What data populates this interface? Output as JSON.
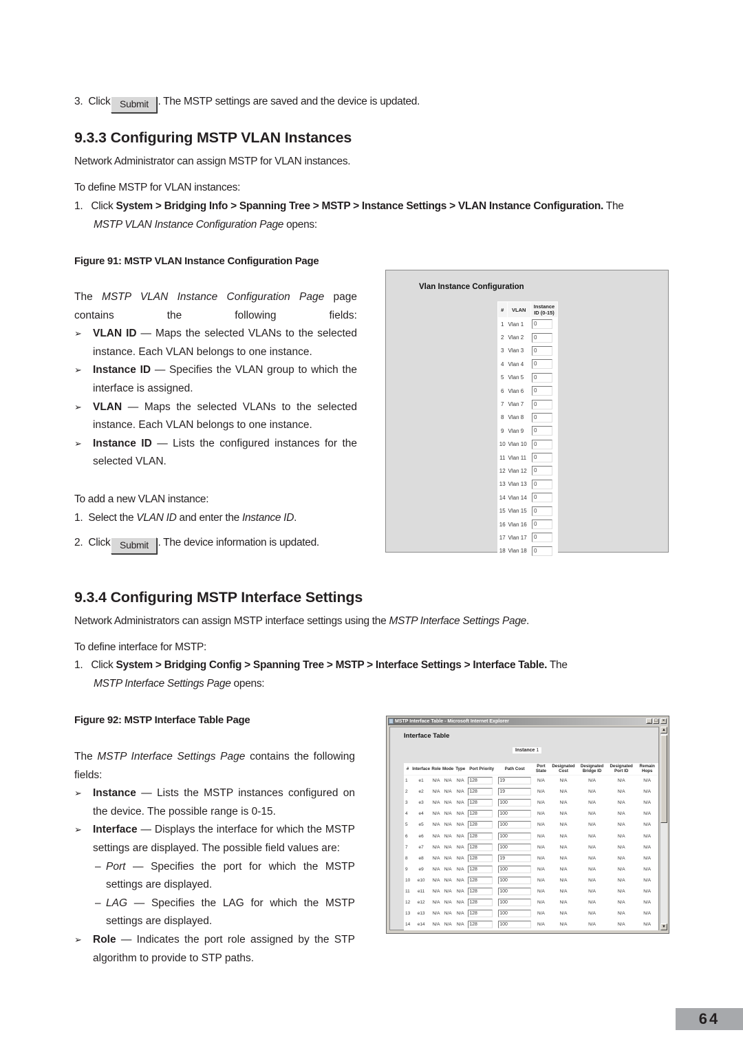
{
  "step3_top": {
    "num": "3.",
    "click": "Click",
    "button": "Submit",
    "rest": ". The MSTP settings are saved and the device is updated."
  },
  "section_933": {
    "heading": "9.3.3  Configuring MSTP VLAN Instances",
    "intro": "Network Administrator can assign MSTP for VLAN instances.",
    "define": "To define MSTP for VLAN instances:",
    "step1": {
      "num": "1.",
      "click": "Click",
      "path": "System > Bridging Info > Spanning Tree > MSTP > Instance Settings > VLAN Instance Configuration.",
      "the": "The",
      "page_name": "MSTP VLAN Instance Configuration Page",
      "opens": "opens:"
    },
    "figure_caption": "Figure 91: MSTP VLAN Instance Configuration Page",
    "fields_intro": {
      "the": "The",
      "page_name": "MSTP VLAN Instance Configuration Page",
      "rest": "page contains the following fields:"
    },
    "fields": [
      {
        "name": "VLAN ID",
        "desc": "— Maps the selected VLANs to the selected instance. Each VLAN belongs to one instance."
      },
      {
        "name": "Instance ID",
        "desc": "— Specifies the VLAN group to which the interface is assigned."
      },
      {
        "name": "VLAN",
        "desc": "— Maps the selected VLANs to the selected instance. Each VLAN belongs to one instance."
      },
      {
        "name": "Instance ID",
        "desc": "— Lists the configured instances for the selected VLAN."
      }
    ],
    "add_intro": "To add a new VLAN instance:",
    "add_step1": {
      "num": "1.",
      "pre": "Select the",
      "vlan_id": "VLAN ID",
      "mid": "and enter the",
      "instance_id": "Instance ID",
      "post": "."
    },
    "add_step2": {
      "num": "2.",
      "click": "Click",
      "button": "Submit",
      "rest": ". The device information is updated."
    }
  },
  "vlan_figure": {
    "title": "Vlan Instance Configuration",
    "headers": [
      "#",
      "VLAN",
      "Instance ID (0-15)"
    ],
    "rows": [
      {
        "num": "1",
        "vlan": "Vlan 1",
        "instance": "0"
      },
      {
        "num": "2",
        "vlan": "Vlan 2",
        "instance": "0"
      },
      {
        "num": "3",
        "vlan": "Vlan 3",
        "instance": "0"
      },
      {
        "num": "4",
        "vlan": "Vlan 4",
        "instance": "0"
      },
      {
        "num": "5",
        "vlan": "Vlan 5",
        "instance": "0"
      },
      {
        "num": "6",
        "vlan": "Vlan 6",
        "instance": "0"
      },
      {
        "num": "7",
        "vlan": "Vlan 7",
        "instance": "0"
      },
      {
        "num": "8",
        "vlan": "Vlan 8",
        "instance": "0"
      },
      {
        "num": "9",
        "vlan": "Vlan 9",
        "instance": "0"
      },
      {
        "num": "10",
        "vlan": "Vlan 10",
        "instance": "0"
      },
      {
        "num": "11",
        "vlan": "Vlan 11",
        "instance": "0"
      },
      {
        "num": "12",
        "vlan": "Vlan 12",
        "instance": "0"
      },
      {
        "num": "13",
        "vlan": "Vlan 13",
        "instance": "0"
      },
      {
        "num": "14",
        "vlan": "Vlan 14",
        "instance": "0"
      },
      {
        "num": "15",
        "vlan": "Vlan 15",
        "instance": "0"
      },
      {
        "num": "16",
        "vlan": "Vlan 16",
        "instance": "0"
      },
      {
        "num": "17",
        "vlan": "Vlan 17",
        "instance": "0"
      },
      {
        "num": "18",
        "vlan": "Vlan 18",
        "instance": "0"
      }
    ]
  },
  "section_934": {
    "heading": "9.3.4  Configuring MSTP Interface Settings",
    "intro_pre": "Network Administrators can assign MSTP interface settings using the",
    "intro_page": "MSTP Interface Settings Page",
    "intro_post": ".",
    "define": "To define interface for MSTP:",
    "step1": {
      "num": "1.",
      "click": "Click",
      "path": "System > Bridging Config > Spanning Tree > MSTP > Interface Settings > Interface Table.",
      "the": "The",
      "page_name": "MSTP Interface Settings Page",
      "opens": "opens:"
    },
    "figure_caption": "Figure 92: MSTP Interface Table Page",
    "fields_intro": {
      "the": "The",
      "page_name": "MSTP Interface Settings Page",
      "rest": "contains the following fields:"
    },
    "fields": [
      {
        "name": "Instance",
        "desc": "— Lists the MSTP instances configured on the device. The possible range is 0-15."
      },
      {
        "name": "Interface",
        "desc": "— Displays the interface for which the MSTP settings are displayed. The possible field values are:"
      },
      {
        "name": "Role",
        "desc": "— Indicates the port role assigned by the STP algorithm to provide to STP paths."
      }
    ],
    "sub_values": [
      {
        "name": "Port",
        "desc": "— Specifies the port for which the MSTP settings are displayed."
      },
      {
        "name": "LAG",
        "desc": "— Specifies the LAG for which the MSTP settings are displayed."
      }
    ]
  },
  "interface_figure": {
    "window_title": "MSTP Interface Table - Microsoft Internet Explorer",
    "page_title": "Interface Table",
    "instance_label": "Instance",
    "instance_value": "1",
    "headers": [
      "#",
      "Interface",
      "Role",
      "Mode",
      "Type",
      "Port Priority",
      "Path Cost",
      "Port State",
      "Designated Cost",
      "Designated Bridge ID",
      "Designated Port ID",
      "Remain Hops"
    ],
    "rows": [
      {
        "num": "1",
        "iface": "e1",
        "role": "N/A",
        "mode": "N/A",
        "type": "N/A",
        "priority": "128",
        "cost": "19",
        "state": "N/A",
        "dcost": "N/A",
        "dbridge": "N/A",
        "dport": "N/A",
        "hops": "N/A"
      },
      {
        "num": "2",
        "iface": "e2",
        "role": "N/A",
        "mode": "N/A",
        "type": "N/A",
        "priority": "128",
        "cost": "19",
        "state": "N/A",
        "dcost": "N/A",
        "dbridge": "N/A",
        "dport": "N/A",
        "hops": "N/A"
      },
      {
        "num": "3",
        "iface": "e3",
        "role": "N/A",
        "mode": "N/A",
        "type": "N/A",
        "priority": "128",
        "cost": "100",
        "state": "N/A",
        "dcost": "N/A",
        "dbridge": "N/A",
        "dport": "N/A",
        "hops": "N/A"
      },
      {
        "num": "4",
        "iface": "e4",
        "role": "N/A",
        "mode": "N/A",
        "type": "N/A",
        "priority": "128",
        "cost": "100",
        "state": "N/A",
        "dcost": "N/A",
        "dbridge": "N/A",
        "dport": "N/A",
        "hops": "N/A"
      },
      {
        "num": "5",
        "iface": "e5",
        "role": "N/A",
        "mode": "N/A",
        "type": "N/A",
        "priority": "128",
        "cost": "100",
        "state": "N/A",
        "dcost": "N/A",
        "dbridge": "N/A",
        "dport": "N/A",
        "hops": "N/A"
      },
      {
        "num": "6",
        "iface": "e6",
        "role": "N/A",
        "mode": "N/A",
        "type": "N/A",
        "priority": "128",
        "cost": "100",
        "state": "N/A",
        "dcost": "N/A",
        "dbridge": "N/A",
        "dport": "N/A",
        "hops": "N/A"
      },
      {
        "num": "7",
        "iface": "e7",
        "role": "N/A",
        "mode": "N/A",
        "type": "N/A",
        "priority": "128",
        "cost": "100",
        "state": "N/A",
        "dcost": "N/A",
        "dbridge": "N/A",
        "dport": "N/A",
        "hops": "N/A"
      },
      {
        "num": "8",
        "iface": "e8",
        "role": "N/A",
        "mode": "N/A",
        "type": "N/A",
        "priority": "128",
        "cost": "19",
        "state": "N/A",
        "dcost": "N/A",
        "dbridge": "N/A",
        "dport": "N/A",
        "hops": "N/A"
      },
      {
        "num": "9",
        "iface": "e9",
        "role": "N/A",
        "mode": "N/A",
        "type": "N/A",
        "priority": "128",
        "cost": "100",
        "state": "N/A",
        "dcost": "N/A",
        "dbridge": "N/A",
        "dport": "N/A",
        "hops": "N/A"
      },
      {
        "num": "10",
        "iface": "e10",
        "role": "N/A",
        "mode": "N/A",
        "type": "N/A",
        "priority": "128",
        "cost": "100",
        "state": "N/A",
        "dcost": "N/A",
        "dbridge": "N/A",
        "dport": "N/A",
        "hops": "N/A"
      },
      {
        "num": "11",
        "iface": "e11",
        "role": "N/A",
        "mode": "N/A",
        "type": "N/A",
        "priority": "128",
        "cost": "100",
        "state": "N/A",
        "dcost": "N/A",
        "dbridge": "N/A",
        "dport": "N/A",
        "hops": "N/A"
      },
      {
        "num": "12",
        "iface": "e12",
        "role": "N/A",
        "mode": "N/A",
        "type": "N/A",
        "priority": "128",
        "cost": "100",
        "state": "N/A",
        "dcost": "N/A",
        "dbridge": "N/A",
        "dport": "N/A",
        "hops": "N/A"
      },
      {
        "num": "13",
        "iface": "e13",
        "role": "N/A",
        "mode": "N/A",
        "type": "N/A",
        "priority": "128",
        "cost": "100",
        "state": "N/A",
        "dcost": "N/A",
        "dbridge": "N/A",
        "dport": "N/A",
        "hops": "N/A"
      },
      {
        "num": "14",
        "iface": "e14",
        "role": "N/A",
        "mode": "N/A",
        "type": "N/A",
        "priority": "128",
        "cost": "100",
        "state": "N/A",
        "dcost": "N/A",
        "dbridge": "N/A",
        "dport": "N/A",
        "hops": "N/A"
      }
    ]
  },
  "page_number": "64"
}
